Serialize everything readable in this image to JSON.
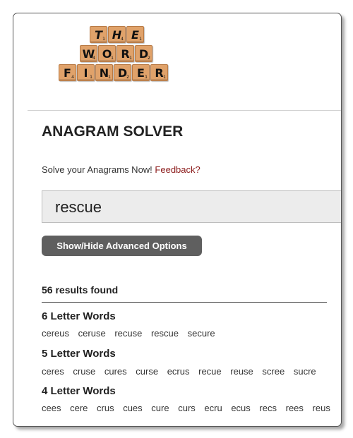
{
  "logo": {
    "rows": [
      [
        "T",
        "H",
        "E"
      ],
      [
        "W",
        "O",
        "R",
        "D"
      ],
      [
        "F",
        "I",
        "N",
        "D",
        "E",
        "R"
      ]
    ],
    "tile_numbers": [
      [
        "1",
        "4",
        "1"
      ],
      [
        "4",
        "1",
        "1",
        "2"
      ],
      [
        "4",
        "1",
        "1",
        "2",
        "1",
        "1"
      ]
    ]
  },
  "page": {
    "title": "ANAGRAM SOLVER",
    "subtitle": "Solve your Anagrams Now!",
    "feedback_link": "Feedback?"
  },
  "search": {
    "value": "rescue"
  },
  "advanced_button": "Show/Hide Advanced Options",
  "results": {
    "count_text": "56 results found",
    "groups": [
      {
        "title": "6 Letter Words",
        "words": [
          "cereus",
          "ceruse",
          "recuse",
          "rescue",
          "secure"
        ]
      },
      {
        "title": "5 Letter Words",
        "words": [
          "ceres",
          "cruse",
          "cures",
          "curse",
          "ecrus",
          "recue",
          "reuse",
          "scree",
          "sucre"
        ]
      },
      {
        "title": "4 Letter Words",
        "words": [
          "cees",
          "cere",
          "crus",
          "cues",
          "cure",
          "curs",
          "ecru",
          "ecus",
          "recs",
          "rees",
          "reus"
        ]
      }
    ]
  },
  "colors": {
    "tile": "#e0a26a",
    "button": "#5f5f5f",
    "link": "#8b1a1a"
  }
}
